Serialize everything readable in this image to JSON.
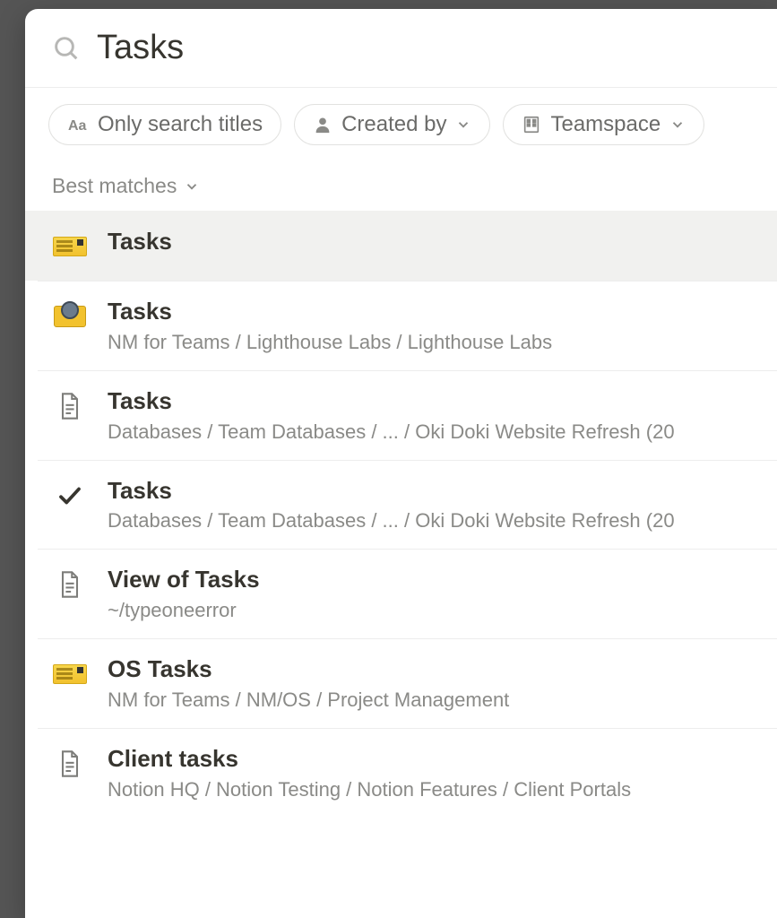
{
  "search": {
    "query": "Tasks"
  },
  "filters": {
    "titles_only": "Only search titles",
    "created_by": "Created by",
    "teamspace": "Teamspace"
  },
  "sort": {
    "label": "Best matches"
  },
  "results": [
    {
      "icon": "ticket",
      "title": "Tasks",
      "path": "",
      "selected": true
    },
    {
      "icon": "camera",
      "title": "Tasks",
      "path": "NM for Teams / Lighthouse Labs / Lighthouse Labs"
    },
    {
      "icon": "page",
      "title": "Tasks",
      "path": "Databases / Team Databases / ... / Oki Doki Website Refresh (20"
    },
    {
      "icon": "check",
      "title": "Tasks",
      "path": "Databases / Team Databases / ... / Oki Doki Website Refresh (20"
    },
    {
      "icon": "page",
      "title": "View of Tasks",
      "path": "~/typeoneerror"
    },
    {
      "icon": "ticket",
      "title": "OS Tasks",
      "path": "NM for Teams / NM/OS / Project Management"
    },
    {
      "icon": "page",
      "title": "Client tasks",
      "path": "Notion HQ / Notion Testing / Notion Features / Client Portals"
    }
  ]
}
